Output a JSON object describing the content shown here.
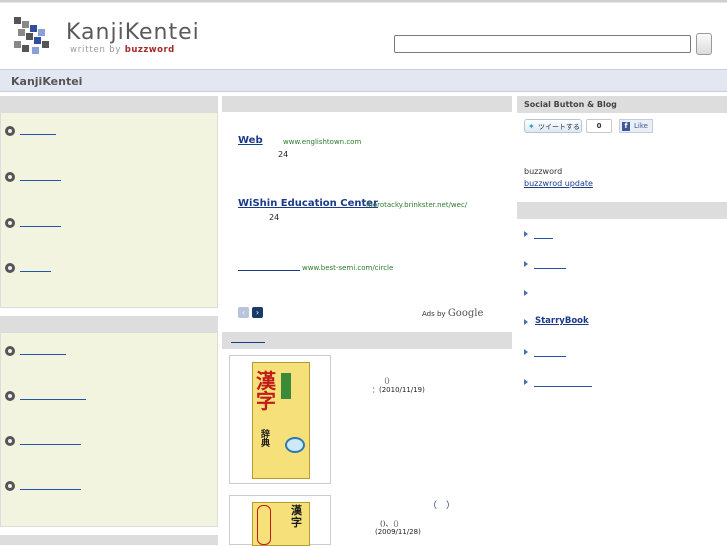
{
  "header": {
    "logo_title": "KanjiKentei",
    "logo_sub_prefix": "written by",
    "logo_sub_brand": "buzzword"
  },
  "titlebar": {
    "label": "KanjiKentei"
  },
  "ads": [
    {
      "title": "Web",
      "url": "www.englishtown.com",
      "detail": "24"
    },
    {
      "title": "WiShin Education Center",
      "url": "morotacky.brinkster.net/wec/",
      "detail": "24"
    },
    {
      "title": "",
      "url": "www.best-semi.com/circle",
      "detail": ""
    }
  ],
  "ads_footer": {
    "prefix": "Ads by",
    "brand": "Google"
  },
  "books": [
    {
      "line1": "（）",
      "line2": "：(2010/11/19)"
    },
    {
      "line0": "（　）",
      "line1": "()、（）",
      "line2": "(2009/11/28)"
    }
  ],
  "right": {
    "social_header": "Social Button & Blog",
    "tweet_label": "ツイートする",
    "tweet_count": "0",
    "like_label": "Like",
    "blog_name": "buzzword",
    "blog_link": "buzzwrod update",
    "links": [
      "",
      "",
      "",
      "StarryBook",
      "",
      ""
    ]
  },
  "colors": {
    "accent": "#1a3a8a",
    "panel_bg": "#f3f4df",
    "titlebar_bg": "#e3e7f2"
  }
}
